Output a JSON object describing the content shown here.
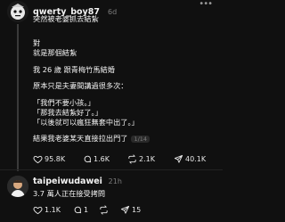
{
  "post1": {
    "username": "qwerty_boy87",
    "time": "6d",
    "lines": [
      "突然被老婆抓去結紮",
      "",
      "對",
      "就是那個結紮",
      "",
      "我 26 歲 跟青梅竹馬結婚",
      "",
      "原本只是夫妻間講過很多次：",
      "",
      "「我們不要小孩。」",
      "「那我去結紮好了。」",
      "「以後就可以瘋狂無套中出了。」",
      "",
      "結果我老婆某天直接拉出門了"
    ],
    "page_indicator": "1/14",
    "likes": "95.8K",
    "comments": "1.6K",
    "reposts": "2.1K",
    "shares": "40.1K"
  },
  "post2": {
    "username": "taipeiwudawei",
    "time": "21h",
    "text": "3.7 萬人正在接受拷問",
    "likes": "1.1K",
    "comments": "1",
    "reposts": "",
    "shares": "15"
  }
}
